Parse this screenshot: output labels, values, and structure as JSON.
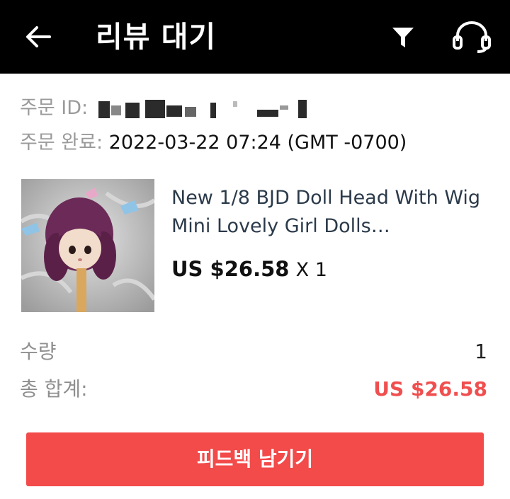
{
  "header": {
    "title": "리뷰 대기",
    "back_icon": "arrow-left-icon",
    "filter_icon": "filter-icon",
    "support_icon": "headset-icon"
  },
  "order": {
    "id_label": "주문 ID:",
    "completed_label": "주문 완료:",
    "completed_value": "2022-03-22 07:24 (GMT -0700)"
  },
  "product": {
    "title": "New 1/8 BJD Doll Head With Wig Mini Lovely Girl Dolls…",
    "price": "US $26.58",
    "quantity": "X 1"
  },
  "summary": {
    "quantity_label": "수량",
    "quantity_value": "1",
    "total_label": "총 합계:",
    "total_value": "US $26.58"
  },
  "actions": {
    "feedback_label": "피드백 남기기"
  },
  "colors": {
    "header_bg": "#000000",
    "accent": "#f34a4a",
    "total_text": "#f04f4f"
  }
}
